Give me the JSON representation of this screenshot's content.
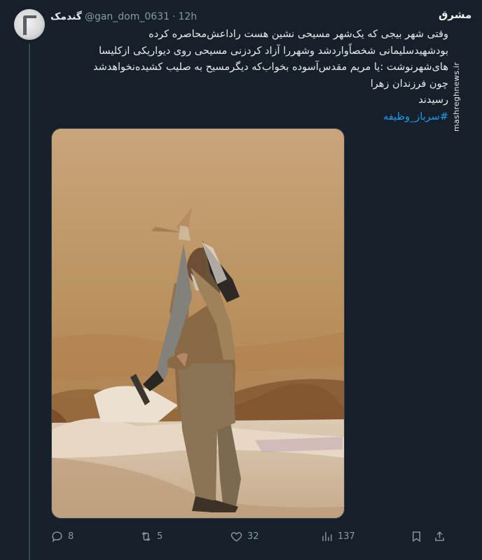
{
  "tweet": {
    "display_name": "گندمک",
    "handle": "@gan_dom_0631",
    "separator": "·",
    "time": "12h",
    "text_lines": [
      "وقتی شهر بیجی که یک‌شهر مسیحی نشین هست راداعش‌محاصره کرده",
      "بودشهیدسلیمانی شخصاًواردشد وشهررا آزاد کردزنی مسیحی روی دیواریکی ازکلیسا",
      "های‌شهرنوشت :یا مریم مقدس‌آسوده بخواب‌که دیگرمسیح به صلیب کشیده‌نخواهدشد",
      "چون فرزندان زهرا",
      "رسیدند"
    ],
    "hashtag": "#سرباز_وظیفه"
  },
  "watermark": {
    "logo": "مشرق",
    "url": "mashreghnews.ir"
  },
  "actions": {
    "replies": "8",
    "retweets": "5",
    "likes": "32",
    "views": "137"
  },
  "icons": {
    "reply": "reply-icon",
    "retweet": "retweet-icon",
    "like": "heart-icon",
    "views": "views-icon",
    "bookmark": "bookmark-icon",
    "share": "share-icon"
  },
  "colors": {
    "background": "#15202b",
    "text": "#e7e9ea",
    "muted": "#8b98a5",
    "link": "#1d9bf0"
  }
}
